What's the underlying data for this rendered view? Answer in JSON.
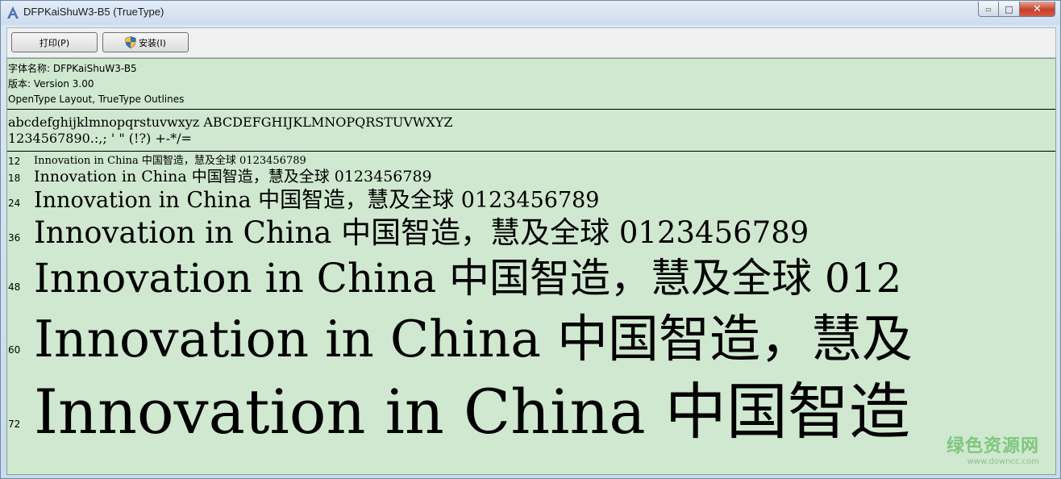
{
  "window": {
    "title": "DFPKaiShuW3-B5 (TrueType)",
    "caption": {
      "minimize": "▭",
      "maximize": "□",
      "close": "✕"
    }
  },
  "toolbar": {
    "print_label": "打印(P)",
    "install_label": "安装(I)"
  },
  "font_info": {
    "name_line": "字体名称: DFPKaiShuW3-B5",
    "version_line": "版本: Version 3.00",
    "type_line": "OpenType Layout, TrueType Outlines"
  },
  "charset": {
    "letters": "abcdefghijklmnopqrstuvwxyz ABCDEFGHIJKLMNOPQRSTUVWXYZ",
    "digits_symbols": "1234567890.:,; ' \" (!?) +-*/="
  },
  "samples": [
    {
      "size": "12",
      "text": "Innovation in China 中国智造，慧及全球 0123456789"
    },
    {
      "size": "18",
      "text": "Innovation in China 中国智造，慧及全球 0123456789"
    },
    {
      "size": "24",
      "text": "Innovation in China 中国智造，慧及全球 0123456789"
    },
    {
      "size": "36",
      "text": "Innovation in China 中国智造，慧及全球 0123456789"
    },
    {
      "size": "48",
      "text": "Innovation in China 中国智造，慧及全球 012"
    },
    {
      "size": "60",
      "text": "Innovation in China 中国智造，慧及"
    },
    {
      "size": "72",
      "text": "Innovation in China 中国智造"
    }
  ],
  "watermark": {
    "main": "绿色资源网",
    "sub": "www.downcc.com"
  }
}
